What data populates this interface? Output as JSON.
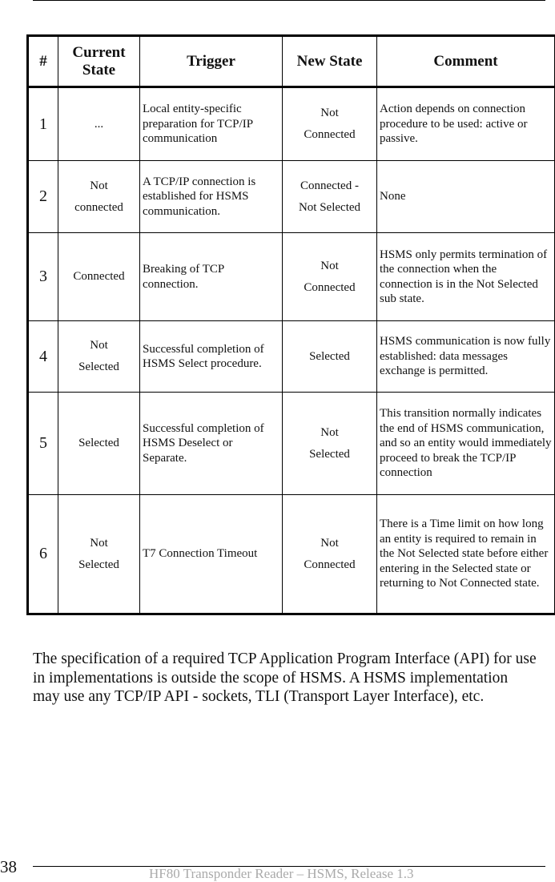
{
  "table": {
    "headers": {
      "num": "#",
      "current_state": "Current State",
      "trigger": "Trigger",
      "new_state": "New State",
      "comment": "Comment"
    },
    "rows": [
      {
        "num": "1",
        "current_state": [
          "..."
        ],
        "trigger": "Local entity-specific preparation for TCP/IP communication",
        "new_state": [
          "Not",
          "Connected"
        ],
        "comment": "Action depends on connection procedure to be used: active or passive."
      },
      {
        "num": "2",
        "current_state": [
          "Not",
          "connected"
        ],
        "trigger": "A TCP/IP connection is established for HSMS communication.",
        "new_state": [
          "Connected -",
          "Not Selected"
        ],
        "comment": "None"
      },
      {
        "num": "3",
        "current_state": [
          "Connected"
        ],
        "trigger": "Breaking of TCP connection.",
        "new_state": [
          "Not",
          "Connected"
        ],
        "comment": "HSMS only permits termination of the connection when the connection is in the Not Selected sub state."
      },
      {
        "num": "4",
        "current_state": [
          "Not",
          "Selected"
        ],
        "trigger": "Successful completion of HSMS Select procedure.",
        "new_state": [
          "Selected"
        ],
        "comment": "HSMS communication is now fully established: data messages exchange is permitted."
      },
      {
        "num": "5",
        "current_state": [
          "Selected"
        ],
        "trigger": "Successful completion of HSMS Deselect or Separate.",
        "new_state": [
          "Not",
          "Selected"
        ],
        "comment": "This transition normally indicates the end of HSMS communication, and so an entity would immediately proceed to break the TCP/IP connection"
      },
      {
        "num": "6",
        "current_state": [
          "Not",
          "Selected"
        ],
        "trigger": "T7 Connection Timeout",
        "new_state": [
          "Not",
          "Connected"
        ],
        "comment": "There is a Time limit on how long an entity is required to remain in the Not Selected state before either entering in the Selected state or returning to Not Connected state."
      }
    ]
  },
  "body_text": "The specification of a required TCP Application Program Interface (API) for use in implementations is outside the scope of HSMS. A HSMS implementation may use any TCP/IP API - sockets, TLI (Transport Layer Interface), etc.",
  "footer": {
    "page_number": "38",
    "title": "HF80 Transponder Reader – HSMS, Release 1.3"
  }
}
